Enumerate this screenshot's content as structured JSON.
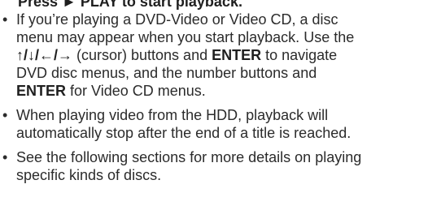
{
  "heading": {
    "prefix": "Press ",
    "play_symbol": "►",
    "suffix": " PLAY to start playback."
  },
  "bullets": [
    {
      "line1": "If you’re playing a DVD-Video or Video CD, a disc",
      "line2": "menu may appear when you start playback. Use the",
      "line3_arrows": "↑/↓/←/→",
      "line3_text": " (cursor) buttons and ",
      "line3_enter": "ENTER",
      "line3_end": " to navigate",
      "line4": "DVD disc menus, and the number buttons and",
      "line5_enter": "ENTER",
      "line5_end": " for Video CD menus."
    },
    {
      "line1": "When playing video from the HDD, playback will",
      "line2": "automatically stop after the end of a title is reached."
    },
    {
      "line1": "See the following sections for more details on playing",
      "line2": "specific kinds of discs."
    }
  ],
  "bullet_glyph": "•"
}
